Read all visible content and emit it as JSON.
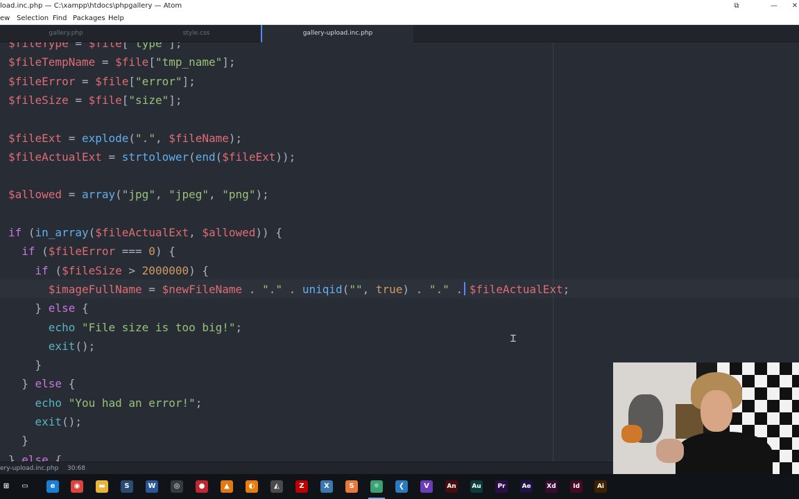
{
  "window": {
    "title": "load.inc.php — C:\\xampp\\htdocs\\phpgallery — Atom",
    "controls": {
      "minimize": "—",
      "maximize": "☐",
      "close": "✕"
    }
  },
  "menu": [
    "ew",
    "Selection",
    "Find",
    "Packages",
    "Help"
  ],
  "tabs": [
    {
      "label": "gallery.php",
      "active": false
    },
    {
      "label": "style.css",
      "active": false
    },
    {
      "label": "gallery-upload.inc.php",
      "active": true
    }
  ],
  "code": [
    [
      [
        "v",
        "$fileType"
      ],
      [
        "o",
        " = "
      ],
      [
        "v",
        "$file"
      ],
      [
        "o",
        "["
      ],
      [
        "s",
        "\"type\""
      ],
      [
        "o",
        "];"
      ]
    ],
    [
      [
        "v",
        "$fileTempName"
      ],
      [
        "o",
        " = "
      ],
      [
        "v",
        "$file"
      ],
      [
        "o",
        "["
      ],
      [
        "s",
        "\"tmp_name\""
      ],
      [
        "o",
        "];"
      ]
    ],
    [
      [
        "v",
        "$fileError"
      ],
      [
        "o",
        " = "
      ],
      [
        "v",
        "$file"
      ],
      [
        "o",
        "["
      ],
      [
        "s",
        "\"error\""
      ],
      [
        "o",
        "];"
      ]
    ],
    [
      [
        "v",
        "$fileSize"
      ],
      [
        "o",
        " = "
      ],
      [
        "v",
        "$file"
      ],
      [
        "o",
        "["
      ],
      [
        "s",
        "\"size\""
      ],
      [
        "o",
        "];"
      ]
    ],
    [],
    [
      [
        "v",
        "$fileExt"
      ],
      [
        "o",
        " = "
      ],
      [
        "f",
        "explode"
      ],
      [
        "o",
        "("
      ],
      [
        "s",
        "\".\""
      ],
      [
        "o",
        ", "
      ],
      [
        "v",
        "$fileName"
      ],
      [
        "o",
        ");"
      ]
    ],
    [
      [
        "v",
        "$fileActualExt"
      ],
      [
        "o",
        " = "
      ],
      [
        "f",
        "strtolower"
      ],
      [
        "o",
        "("
      ],
      [
        "f",
        "end"
      ],
      [
        "o",
        "("
      ],
      [
        "v",
        "$fileExt"
      ],
      [
        "o",
        "));"
      ]
    ],
    [],
    [
      [
        "v",
        "$allowed"
      ],
      [
        "o",
        " = "
      ],
      [
        "f",
        "array"
      ],
      [
        "o",
        "("
      ],
      [
        "s",
        "\"jpg\""
      ],
      [
        "o",
        ", "
      ],
      [
        "s",
        "\"jpeg\""
      ],
      [
        "o",
        ", "
      ],
      [
        "s",
        "\"png\""
      ],
      [
        "o",
        ");"
      ]
    ],
    [],
    [
      [
        "k",
        "if"
      ],
      [
        "o",
        " ("
      ],
      [
        "f",
        "in_array"
      ],
      [
        "o",
        "("
      ],
      [
        "v",
        "$fileActualExt"
      ],
      [
        "o",
        ", "
      ],
      [
        "v",
        "$allowed"
      ],
      [
        "o",
        ")) {"
      ]
    ],
    [
      [
        "o",
        "  "
      ],
      [
        "k",
        "if"
      ],
      [
        "o",
        " ("
      ],
      [
        "v",
        "$fileError"
      ],
      [
        "o",
        " === "
      ],
      [
        "n",
        "0"
      ],
      [
        "o",
        ") {"
      ]
    ],
    [
      [
        "o",
        "    "
      ],
      [
        "k",
        "if"
      ],
      [
        "o",
        " ("
      ],
      [
        "v",
        "$fileSize"
      ],
      [
        "o",
        " > "
      ],
      [
        "n",
        "2000000"
      ],
      [
        "o",
        ") {"
      ]
    ],
    [
      [
        "o",
        "      "
      ],
      [
        "v",
        "$imageFullName"
      ],
      [
        "o",
        " = "
      ],
      [
        "v",
        "$newFileName"
      ],
      [
        "o",
        " . "
      ],
      [
        "s",
        "\".\""
      ],
      [
        "o",
        " . "
      ],
      [
        "f",
        "uniqid"
      ],
      [
        "o",
        "("
      ],
      [
        "s",
        "\"\""
      ],
      [
        "o",
        ", "
      ],
      [
        "n",
        "true"
      ],
      [
        "o",
        ") . "
      ],
      [
        "s",
        "\".\""
      ],
      [
        "o",
        " . "
      ],
      [
        "v",
        "$fileActualExt"
      ],
      [
        "o",
        ";"
      ]
    ],
    [
      [
        "o",
        "    } "
      ],
      [
        "k",
        "else"
      ],
      [
        "o",
        " {"
      ]
    ],
    [
      [
        "o",
        "      "
      ],
      [
        "c",
        "echo"
      ],
      [
        "o",
        " "
      ],
      [
        "s",
        "\"File size is too big!\""
      ],
      [
        "o",
        ";"
      ]
    ],
    [
      [
        "o",
        "      "
      ],
      [
        "c",
        "exit"
      ],
      [
        "o",
        "();"
      ]
    ],
    [
      [
        "o",
        "    }"
      ]
    ],
    [
      [
        "o",
        "  } "
      ],
      [
        "k",
        "else"
      ],
      [
        "o",
        " {"
      ]
    ],
    [
      [
        "o",
        "    "
      ],
      [
        "c",
        "echo"
      ],
      [
        "o",
        " "
      ],
      [
        "s",
        "\"You had an error!\""
      ],
      [
        "o",
        ";"
      ]
    ],
    [
      [
        "o",
        "    "
      ],
      [
        "c",
        "exit"
      ],
      [
        "o",
        "();"
      ]
    ],
    [
      [
        "o",
        "  }"
      ]
    ],
    [
      [
        "o",
        "} "
      ],
      [
        "k",
        "else"
      ],
      [
        "o",
        " {"
      ]
    ]
  ],
  "status": {
    "file": "ery-upload.inc.php",
    "position": "30:68"
  },
  "taskbar": [
    {
      "name": "windows-start-icon",
      "glyph": "⊞",
      "color": "#101317"
    },
    {
      "name": "task-view-icon",
      "glyph": "▭",
      "color": "#101317"
    },
    {
      "name": "edge-icon",
      "glyph": "e",
      "color": "#1b7ed6"
    },
    {
      "name": "chrome-icon",
      "glyph": "◉",
      "color": "#d9453c"
    },
    {
      "name": "file-explorer-icon",
      "glyph": "▬",
      "color": "#e8b43a"
    },
    {
      "name": "steam-icon",
      "glyph": "S",
      "color": "#2a4b74"
    },
    {
      "name": "word-icon",
      "glyph": "W",
      "color": "#2b5797"
    },
    {
      "name": "github-icon",
      "glyph": "◎",
      "color": "#333a40"
    },
    {
      "name": "obs-icon",
      "glyph": "●",
      "color": "#c1272d"
    },
    {
      "name": "vlc-icon",
      "glyph": "▲",
      "color": "#e07a10"
    },
    {
      "name": "blender-icon",
      "glyph": "◐",
      "color": "#e87d0d"
    },
    {
      "name": "inkscape-icon",
      "glyph": "◭",
      "color": "#4a4a4a"
    },
    {
      "name": "filezilla-icon",
      "glyph": "Z",
      "color": "#bf0000"
    },
    {
      "name": "xampp-icon",
      "glyph": "X",
      "color": "#3b78b0"
    },
    {
      "name": "sublime-icon",
      "glyph": "S",
      "color": "#e8793a"
    },
    {
      "name": "atom-icon",
      "glyph": "⚛",
      "color": "#3ba172"
    },
    {
      "name": "vscode-icon",
      "glyph": "❮",
      "color": "#2a7ac0"
    },
    {
      "name": "visual-studio-icon",
      "glyph": "V",
      "color": "#6b3eb8"
    },
    {
      "name": "animate-icon",
      "glyph": "An",
      "color": "#4a0c0c"
    },
    {
      "name": "audition-icon",
      "glyph": "Au",
      "color": "#0b3b3b"
    },
    {
      "name": "premiere-icon",
      "glyph": "Pr",
      "color": "#2a0f46"
    },
    {
      "name": "after-effects-icon",
      "glyph": "Ae",
      "color": "#1f1346"
    },
    {
      "name": "xd-icon",
      "glyph": "Xd",
      "color": "#3a0b30"
    },
    {
      "name": "indesign-icon",
      "glyph": "Id",
      "color": "#450b24"
    },
    {
      "name": "illustrator-icon",
      "glyph": "Ai",
      "color": "#3f2100"
    }
  ]
}
